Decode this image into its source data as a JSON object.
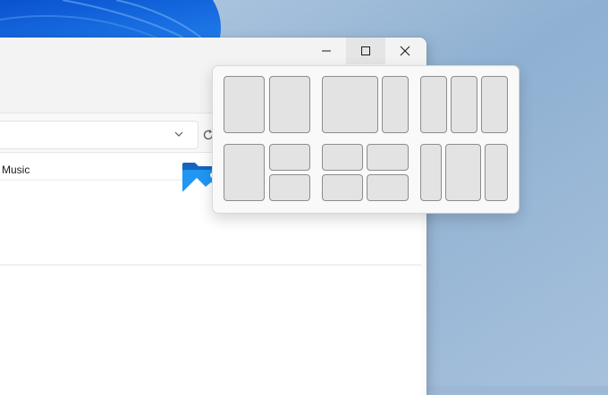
{
  "window": {
    "minimize_icon": "minimize-icon",
    "maximize_icon": "maximize-icon",
    "close_icon": "close-icon"
  },
  "address_bar": {
    "dropdown_icon": "chevron-down-icon",
    "refresh_icon": "refresh-icon"
  },
  "content": {
    "music_label": "Music",
    "folder_icon": "pictures-folder-icon"
  },
  "snap_layouts": {
    "layouts": [
      {
        "name": "two-column-equal",
        "zones": 2
      },
      {
        "name": "two-column-wide-left",
        "zones": 2
      },
      {
        "name": "three-column-equal",
        "zones": 3
      },
      {
        "name": "left-half-right-stacked",
        "zones": 3
      },
      {
        "name": "four-quadrants",
        "zones": 4
      },
      {
        "name": "three-column-wide-center",
        "zones": 3
      }
    ]
  },
  "colors": {
    "wallpaper_blue": "#1565d8",
    "wallpaper_bg": "#9db8d6",
    "flyout_bg": "#f9f9f9",
    "zone_fill": "#e3e3e3",
    "zone_border": "#8c8c8c",
    "folder_blue": "#1e88e5"
  }
}
